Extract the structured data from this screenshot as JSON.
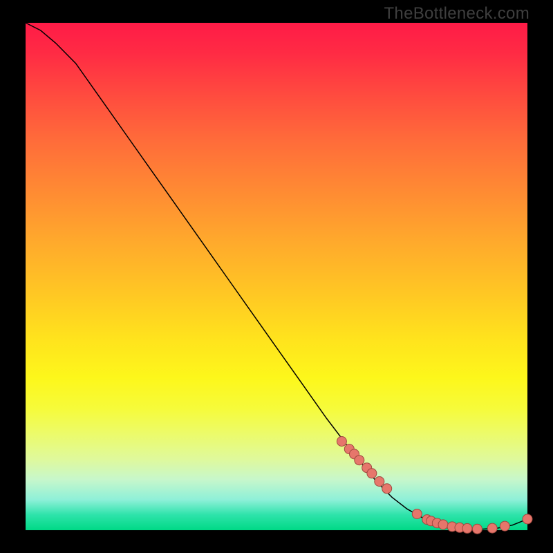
{
  "attribution": "TheBottleneck.com",
  "colors": {
    "frame_bg": "#000000",
    "curve": "#000000",
    "marker_fill": "#e6766b",
    "marker_stroke": "#a0483f",
    "gradient_top": "#ff1b47",
    "gradient_bottom": "#00d986"
  },
  "chart_data": {
    "type": "line",
    "title": "",
    "xlabel": "",
    "ylabel": "",
    "xlim": [
      0,
      100
    ],
    "ylim": [
      0,
      100
    ],
    "grid": false,
    "legend": false,
    "series": [
      {
        "name": "bottleneck-curve",
        "x": [
          0,
          3,
          6,
          10,
          15,
          20,
          25,
          30,
          35,
          40,
          45,
          50,
          55,
          60,
          65,
          70,
          73,
          76,
          79,
          82,
          85,
          88,
          91,
          94,
          97,
          100
        ],
        "y": [
          100,
          98.5,
          96,
          92,
          85,
          78,
          71,
          64,
          57,
          50,
          43,
          36,
          29,
          22,
          15.5,
          9.5,
          6.5,
          4.2,
          2.5,
          1.3,
          0.6,
          0.3,
          0.2,
          0.4,
          1.0,
          2.2
        ]
      }
    ],
    "markers": {
      "name": "highlight-segment",
      "x": [
        63,
        64.5,
        65.5,
        66.5,
        68,
        69,
        70.5,
        72,
        78,
        80,
        80.8,
        82,
        83.2,
        85,
        86.5,
        88,
        90,
        93,
        95.5,
        100
      ],
      "y": [
        17.5,
        16,
        15,
        13.8,
        12.3,
        11.2,
        9.6,
        8.2,
        3.2,
        2.1,
        1.8,
        1.4,
        1.1,
        0.7,
        0.5,
        0.35,
        0.25,
        0.4,
        0.8,
        2.2
      ]
    }
  }
}
